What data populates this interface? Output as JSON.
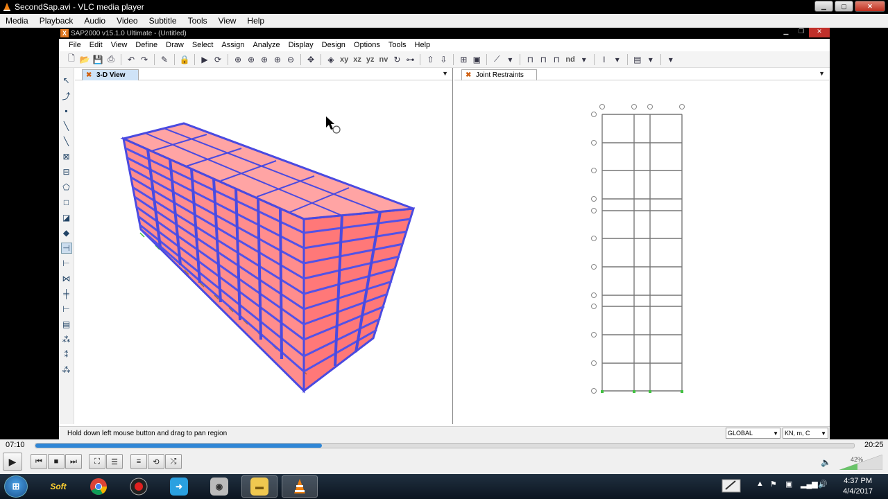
{
  "vlc": {
    "title": "SecondSap.avi - VLC media player",
    "menu": [
      "Media",
      "Playback",
      "Audio",
      "Video",
      "Subtitle",
      "Tools",
      "View",
      "Help"
    ],
    "time_elapsed": "07:10",
    "time_total": "20:25",
    "progress": 0.35,
    "volume_label": "42%",
    "volume": 0.42
  },
  "sap": {
    "title": "SAP2000 v15.1.0 Ultimate  - (Untitled)",
    "logo": "X",
    "menu": [
      "File",
      "Edit",
      "View",
      "Define",
      "Draw",
      "Select",
      "Assign",
      "Analyze",
      "Display",
      "Design",
      "Options",
      "Tools",
      "Help"
    ],
    "toolbar_text": [
      "xy",
      "xz",
      "yz",
      "nv",
      "nd"
    ],
    "left_tab": "3-D View",
    "right_tab": "Joint Restraints",
    "status_text": "Hold down left mouse button and drag to pan region",
    "coord_system": "GLOBAL",
    "units": "KN, m, C"
  },
  "colors": {
    "slab_fill": "#ff3030",
    "frame": "#4a4ae0",
    "support": "#40c040",
    "progress": "#2f86d6"
  },
  "taskbar": {
    "apps": [
      "start-orb",
      "soft-app",
      "chrome",
      "recorder",
      "remote-desktop",
      "camera",
      "file-explorer",
      "vlc"
    ],
    "soft_label": "Soft",
    "time": "4:37 PM",
    "date": "4/4/2017"
  }
}
